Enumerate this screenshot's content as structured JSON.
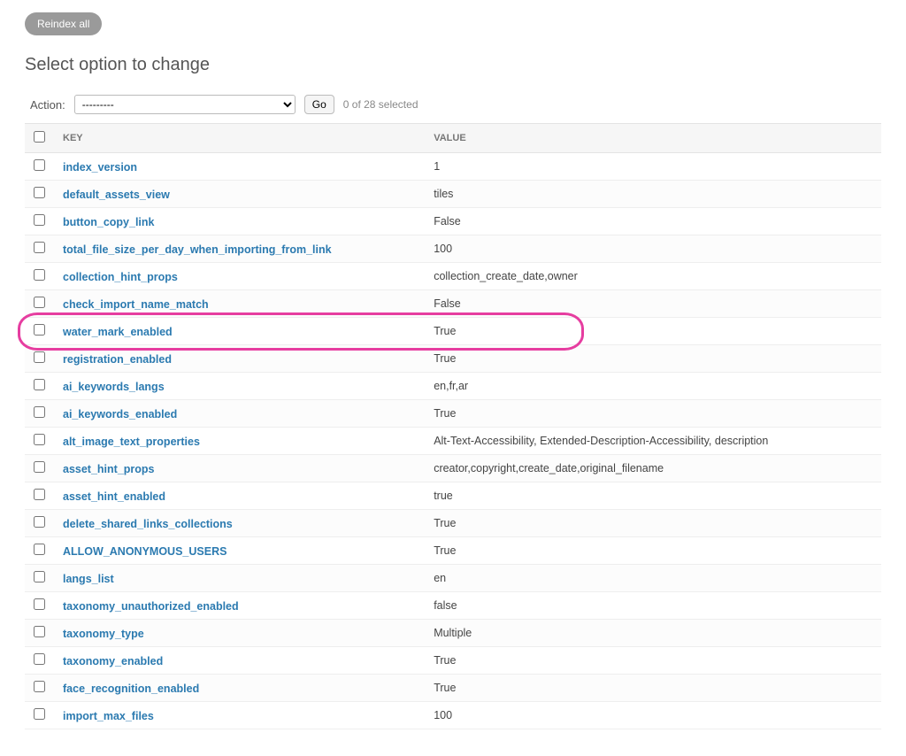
{
  "top_button": "Reindex all",
  "page_title": "Select option to change",
  "action": {
    "label": "Action:",
    "placeholder": "---------",
    "go": "Go",
    "selection_text": "0 of 28 selected"
  },
  "headers": {
    "key": "KEY",
    "value": "VALUE"
  },
  "highlight_key": "water_mark_enabled",
  "rows": [
    {
      "key": "index_version",
      "value": "1"
    },
    {
      "key": "default_assets_view",
      "value": "tiles"
    },
    {
      "key": "button_copy_link",
      "value": "False"
    },
    {
      "key": "total_file_size_per_day_when_importing_from_link",
      "value": "100"
    },
    {
      "key": "collection_hint_props",
      "value": "collection_create_date,owner"
    },
    {
      "key": "check_import_name_match",
      "value": "False"
    },
    {
      "key": "water_mark_enabled",
      "value": "True"
    },
    {
      "key": "registration_enabled",
      "value": "True"
    },
    {
      "key": "ai_keywords_langs",
      "value": "en,fr,ar"
    },
    {
      "key": "ai_keywords_enabled",
      "value": "True"
    },
    {
      "key": "alt_image_text_properties",
      "value": "Alt-Text-Accessibility, Extended-Description-Accessibility, description"
    },
    {
      "key": "asset_hint_props",
      "value": "creator,copyright,create_date,original_filename"
    },
    {
      "key": "asset_hint_enabled",
      "value": "true"
    },
    {
      "key": "delete_shared_links_collections",
      "value": "True"
    },
    {
      "key": "ALLOW_ANONYMOUS_USERS",
      "value": "True"
    },
    {
      "key": "langs_list",
      "value": "en"
    },
    {
      "key": "taxonomy_unauthorized_enabled",
      "value": "false"
    },
    {
      "key": "taxonomy_type",
      "value": "Multiple"
    },
    {
      "key": "taxonomy_enabled",
      "value": "True"
    },
    {
      "key": "face_recognition_enabled",
      "value": "True"
    },
    {
      "key": "import_max_files",
      "value": "100"
    }
  ]
}
